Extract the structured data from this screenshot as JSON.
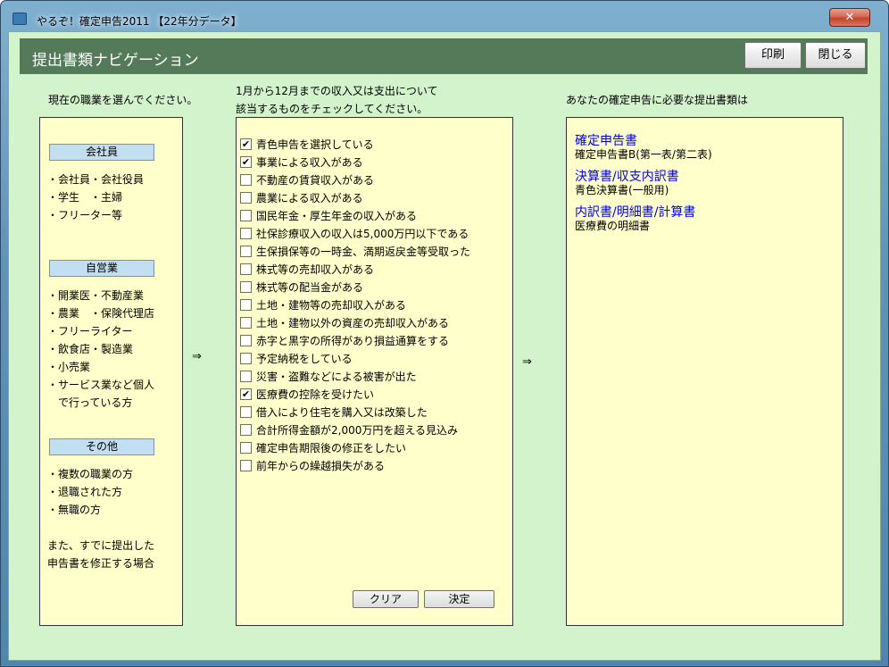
{
  "window": {
    "title": "やるぞ！確定申告2011 【22年分データ】",
    "close_label": "✕"
  },
  "header": {
    "title": "提出書類ナビゲーション",
    "print_label": "印刷",
    "close_label": "閉じる"
  },
  "left": {
    "caption": "現在の職業を選んでください。",
    "categories": [
      {
        "label": "会社員",
        "items": [
          "・会社員・会社役員",
          "・学生　・主婦",
          "・フリーター等"
        ]
      },
      {
        "label": "自営業",
        "items": [
          "・開業医・不動産業",
          "・農業　・保険代理店",
          "・フリーライター",
          "・飲食店・製造業",
          "・小売業",
          "・サービス業など個人",
          "　で行っている方"
        ]
      },
      {
        "label": "その他",
        "items": [
          "・複数の職業の方",
          "・退職された方",
          "・無職の方"
        ]
      }
    ],
    "note_lines": [
      "また、すでに提出した",
      "申告書を修正する場合"
    ]
  },
  "arrow": "⇒",
  "middle": {
    "caption_lines": [
      "1月から12月までの収入又は支出について",
      "該当するものをチェックしてください。"
    ],
    "checks": [
      {
        "label": "青色申告を選択している",
        "checked": true
      },
      {
        "label": "事業による収入がある",
        "checked": true
      },
      {
        "label": "不動産の賃貸収入がある",
        "checked": false
      },
      {
        "label": "農業による収入がある",
        "checked": false
      },
      {
        "label": "国民年金・厚生年金の収入がある",
        "checked": false
      },
      {
        "label": "社保診療収入の収入は5,000万円以下である",
        "checked": false
      },
      {
        "label": "生保損保等の一時金、満期返戻金等受取った",
        "checked": false
      },
      {
        "label": "株式等の売却収入がある",
        "checked": false
      },
      {
        "label": "株式等の配当金がある",
        "checked": false
      },
      {
        "label": "土地・建物等の売却収入がある",
        "checked": false
      },
      {
        "label": "土地・建物以外の資産の売却収入がある",
        "checked": false
      },
      {
        "label": "赤字と黒字の所得があり損益通算をする",
        "checked": false
      },
      {
        "label": "予定納税をしている",
        "checked": false
      },
      {
        "label": "災害・盗難などによる被害が出た",
        "checked": false
      },
      {
        "label": "医療費の控除を受けたい",
        "checked": true
      },
      {
        "label": "借入により住宅を購入又は改築した",
        "checked": false
      },
      {
        "label": "合計所得金額が2,000万円を超える見込み",
        "checked": false
      },
      {
        "label": "確定申告期限後の修正をしたい",
        "checked": false
      },
      {
        "label": "前年からの繰越損失がある",
        "checked": false
      }
    ],
    "clear_label": "クリア",
    "decide_label": "決定"
  },
  "right": {
    "caption": "あなたの確定申告に必要な提出書類は",
    "docs": [
      {
        "link": "確定申告書",
        "detail": "確定申告書B(第一表/第二表)"
      },
      {
        "link": "決算書/収支内訳書",
        "detail": "青色決算書(一般用)"
      },
      {
        "link": "内訳書/明細書/計算書",
        "detail": "医療費の明細書"
      }
    ]
  },
  "colors": {
    "client_bg": "#d3f3cc",
    "header_bg": "#557a59",
    "panel_bg": "#ffffcc",
    "category_bg": "#c2dff2",
    "link": "#0000ee"
  }
}
